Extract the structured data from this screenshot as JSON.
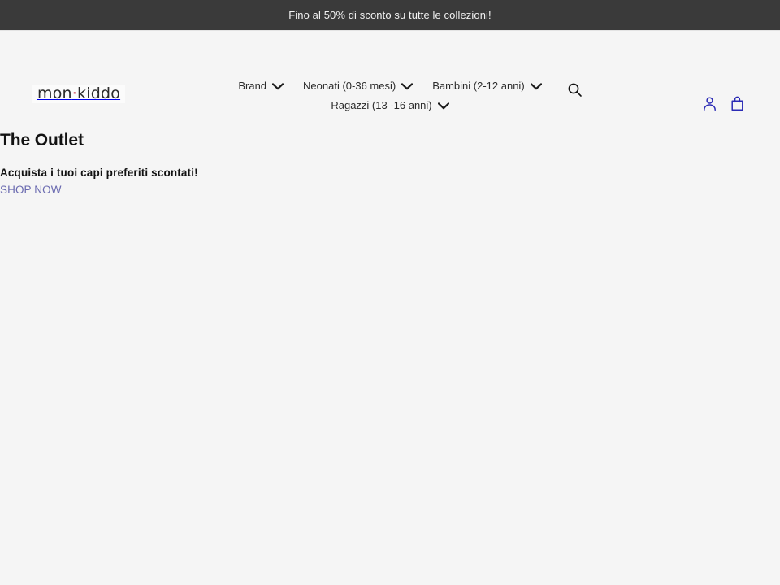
{
  "announcement": {
    "text": "Fino al 50% di sconto su tutte le collezioni!",
    "background": "#3a3a3a",
    "text_color": "#f2f2f2"
  },
  "header": {
    "logo": {
      "text_before_dot": "mon",
      "dot": "·",
      "text_after_dot": "kiddo",
      "dot_color": "#d4556b"
    },
    "nav": [
      {
        "label": "Brand",
        "icon": "chevron-down-icon",
        "has_dropdown": true
      },
      {
        "label": "Neonati (0-36 mesi)",
        "icon": "chevron-down-icon",
        "has_dropdown": true
      },
      {
        "label": "Bambini (2-12 anni)",
        "icon": "chevron-down-icon",
        "has_dropdown": true
      },
      {
        "label": "Ragazzi (13 -16 anni)",
        "icon": "chevron-down-icon",
        "has_dropdown": true
      }
    ],
    "search": {
      "icon": "search-icon"
    },
    "account": {
      "icon": "account-icon"
    },
    "cart": {
      "icon": "cart-icon"
    },
    "icon_color": "#2b2bb5"
  },
  "main": {
    "title": "The Outlet",
    "subtitle": "Acquista i tuoi capi preferiti scontati!",
    "cta_label": "SHOP NOW",
    "cta_color": "#6a6ab0"
  }
}
